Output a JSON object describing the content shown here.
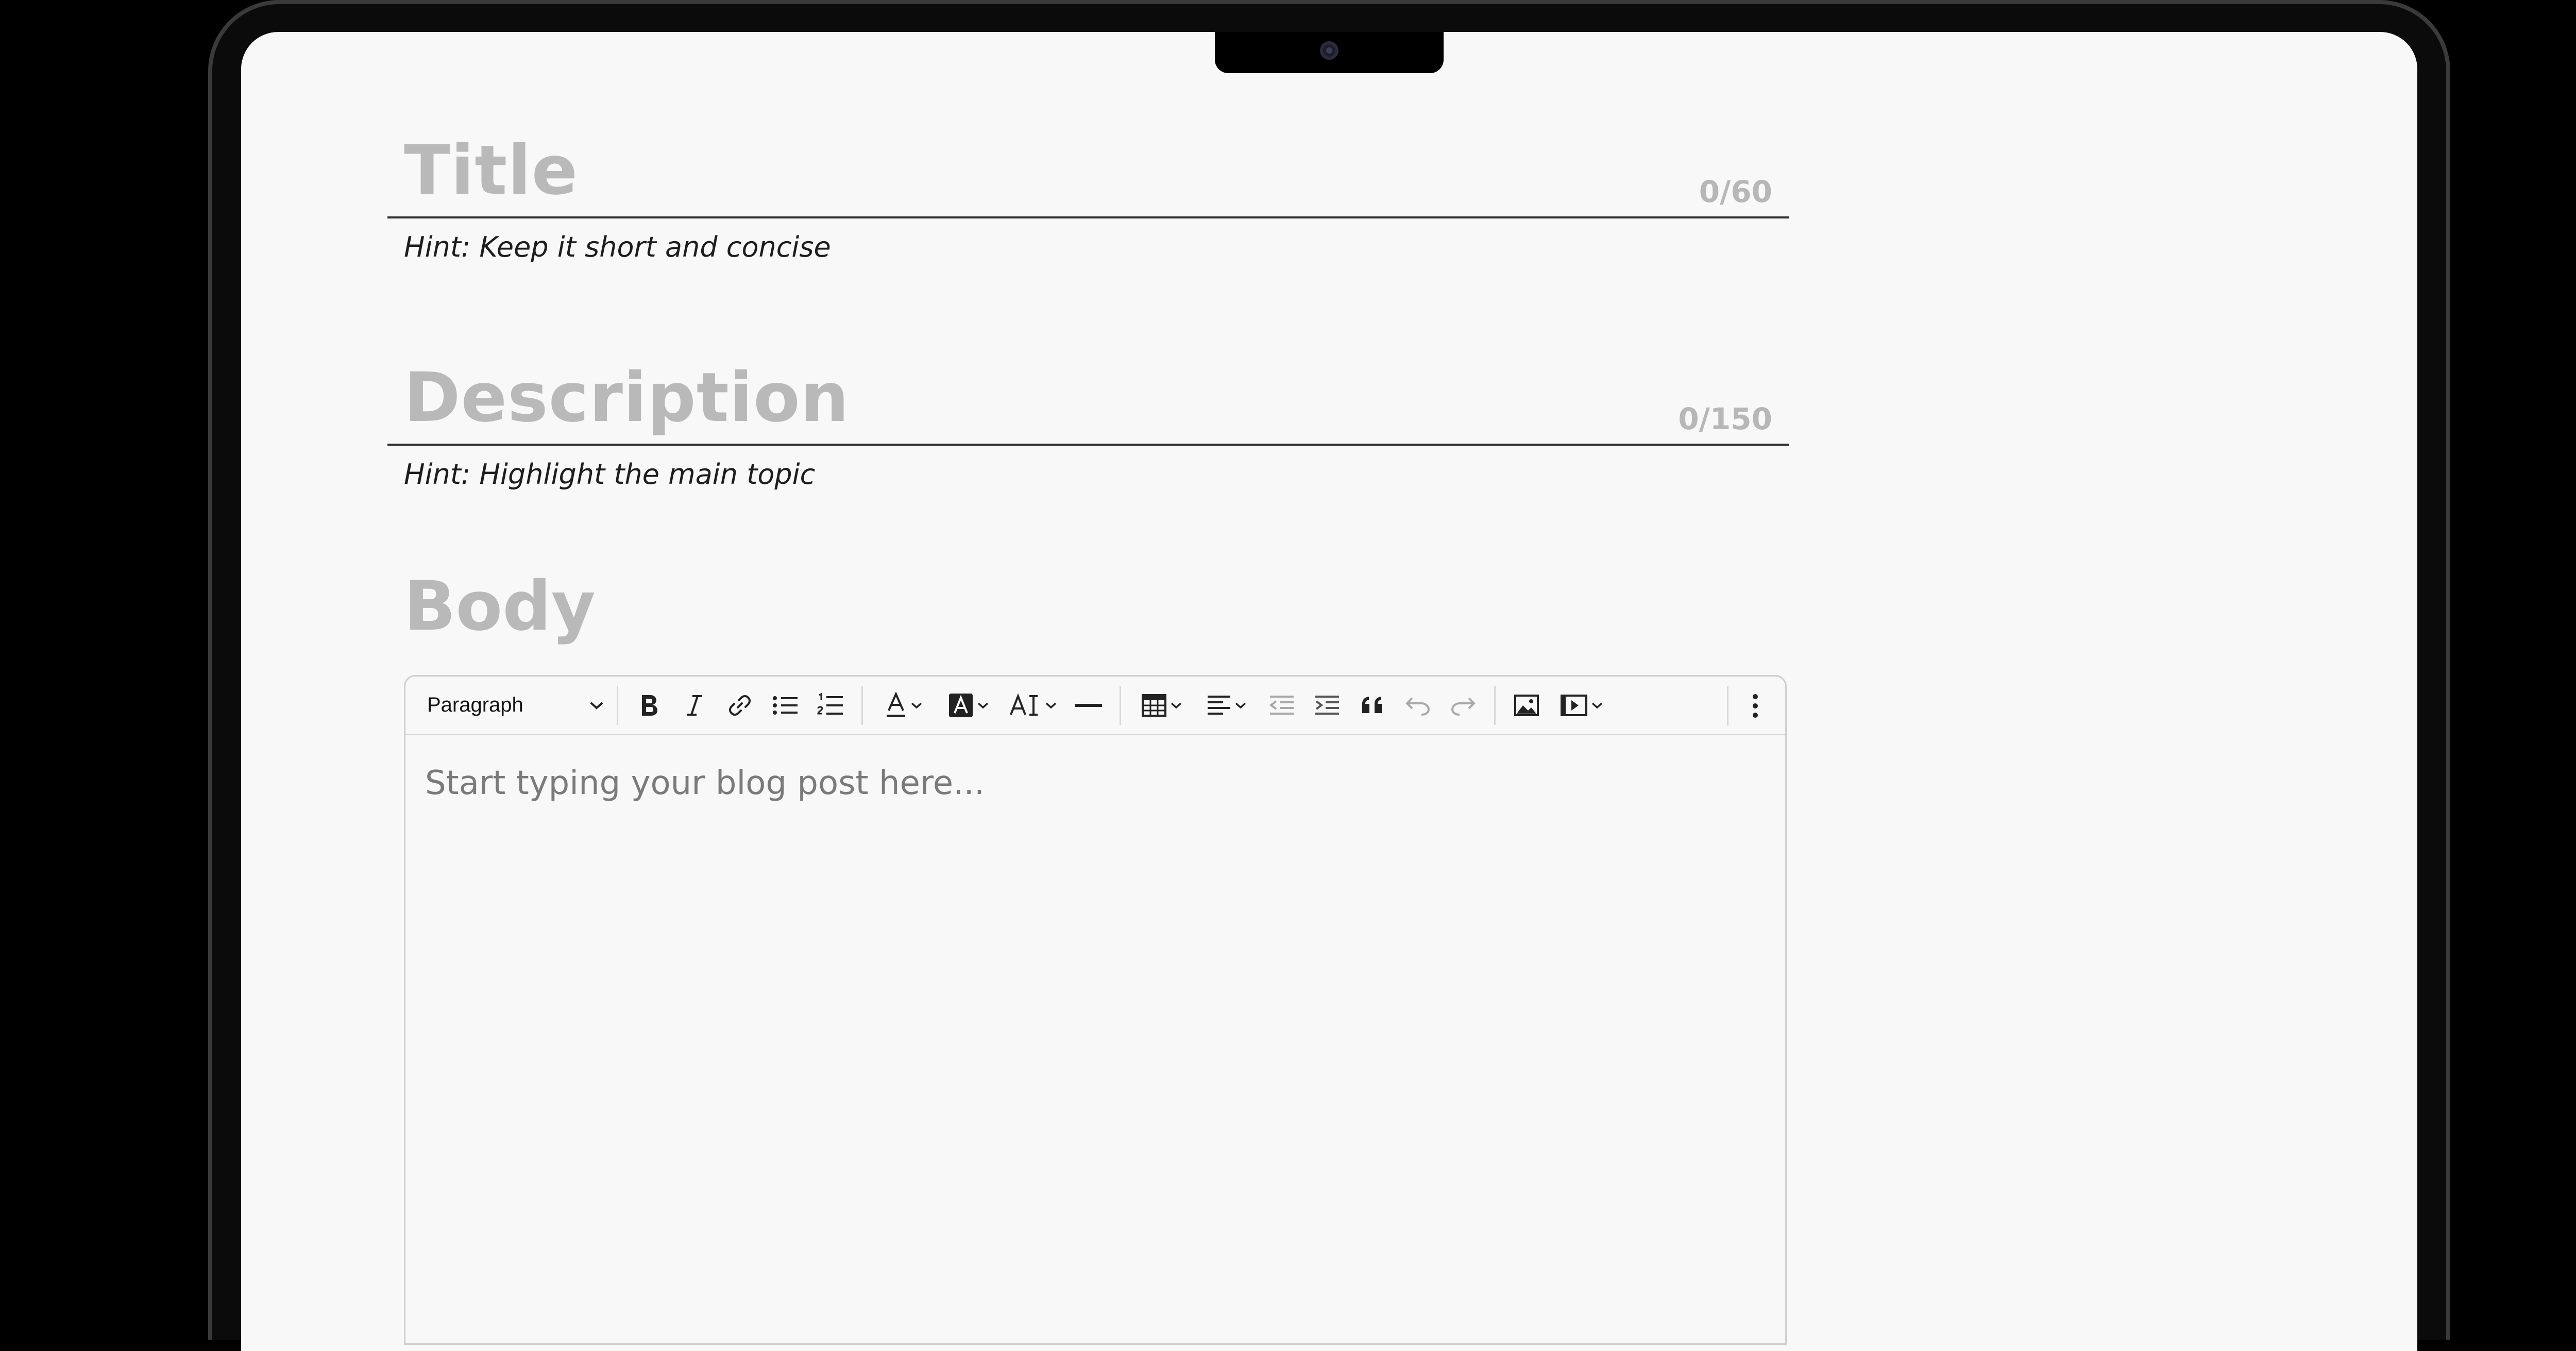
{
  "form": {
    "title": {
      "label": "Title",
      "counter": "0/60",
      "hint": "Hint: Keep it short and concise"
    },
    "description": {
      "label": "Description",
      "counter": "0/150",
      "hint": "Hint: Highlight the main topic"
    },
    "body": {
      "label": "Body"
    }
  },
  "editor": {
    "block_format": "Paragraph",
    "placeholder": "Start typing your blog post here...",
    "toolbar_icons": [
      "bold-icon",
      "italic-icon",
      "link-icon",
      "bullet-list-icon",
      "numbered-list-icon",
      "font-color-icon",
      "highlight-color-icon",
      "font-size-icon",
      "horizontal-line-icon",
      "table-icon",
      "align-left-icon",
      "outdent-icon",
      "indent-icon",
      "blockquote-icon",
      "undo-icon",
      "redo-icon",
      "image-icon",
      "media-icon",
      "more-icon"
    ]
  },
  "colors": {
    "background": "#000000",
    "screen": "#f8f8f8",
    "label_gray": "#b9b9b9",
    "text_dark": "#1d1d1d",
    "placeholder": "#7a7a7a"
  }
}
